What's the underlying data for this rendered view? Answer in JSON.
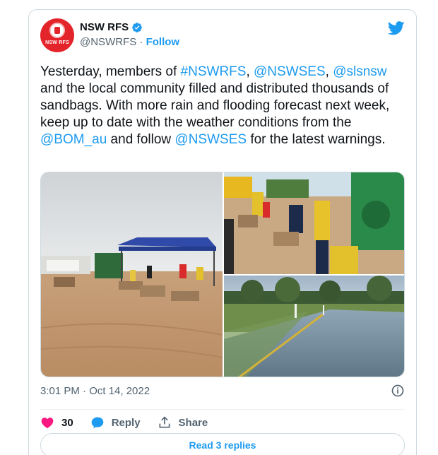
{
  "author": {
    "name": "NSW RFS",
    "handle": "@NSWRFS",
    "separator": "·",
    "follow_label": "Follow",
    "avatar_text": "NSW RFS",
    "verified": true
  },
  "tweet": {
    "p1": "Yesterday, members of ",
    "m1": "#NSWRFS",
    "p2": ", ",
    "m2": "@NSWSES",
    "p3": ", ",
    "m3": "@slsnsw",
    "p4": " and the local community filled and distributed thousands of sandbags. With more rain and flooding forecast next week, keep up to date with the weather conditions from the ",
    "m4": "@BOM_au",
    "p5": " and follow ",
    "m5": "@NSWSES",
    "p6": " for the latest warnings."
  },
  "media": [
    {
      "name": "photo-sandbag-station",
      "icon": "photo"
    },
    {
      "name": "photo-volunteers-filling-bags",
      "icon": "photo"
    },
    {
      "name": "photo-flooded-road",
      "icon": "photo"
    }
  ],
  "meta": {
    "timestamp": "3:01 PM · Oct 14, 2022"
  },
  "actions": {
    "like_count": "30",
    "reply_label": "Reply",
    "share_label": "Share"
  },
  "read_replies_label": "Read 3 replies",
  "colors": {
    "accent": "#1d9bf0",
    "like": "#f91880",
    "text": "#0f1419",
    "muted": "#536471",
    "border": "#cfd9de",
    "avatar": "#e3242b"
  }
}
